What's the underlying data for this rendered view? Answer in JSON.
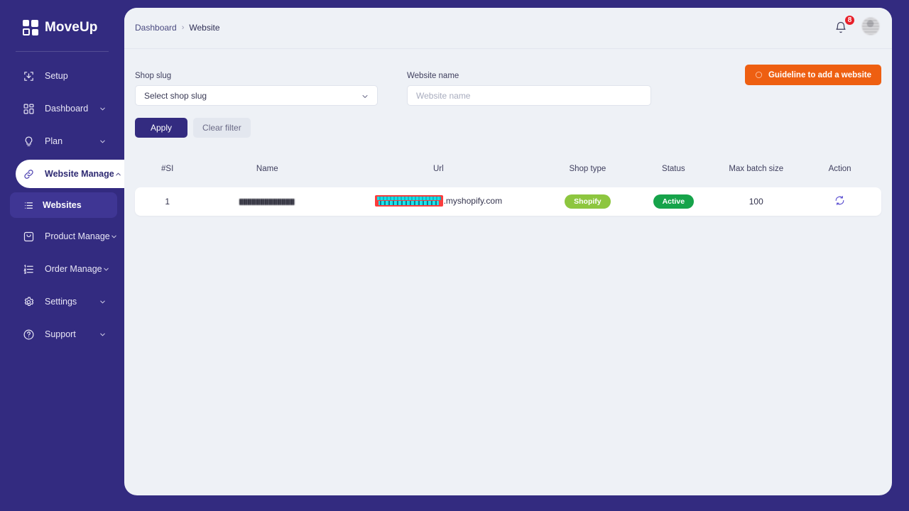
{
  "brand": {
    "name": "MoveUp",
    "sidebar_color": "#332b80",
    "accent_color": "#332b80",
    "orange_color": "#ee5f11"
  },
  "sidebar": {
    "items": [
      {
        "label": "Setup",
        "icon": "download-box-icon",
        "has_chevron": false,
        "active": false
      },
      {
        "label": "Dashboard",
        "icon": "grid-icon",
        "has_chevron": true,
        "active": false
      },
      {
        "label": "Plan",
        "icon": "lightbulb-icon",
        "has_chevron": true,
        "active": false
      },
      {
        "label": "Website Manage",
        "icon": "link-icon",
        "has_chevron": true,
        "active": true
      },
      {
        "label": "Product Manage",
        "icon": "bag-icon",
        "has_chevron": true,
        "active": false
      },
      {
        "label": "Order Manage",
        "icon": "ordered-list-icon",
        "has_chevron": true,
        "active": false
      },
      {
        "label": "Settings",
        "icon": "gear-icon",
        "has_chevron": true,
        "active": false
      },
      {
        "label": "Support",
        "icon": "question-circle-icon",
        "has_chevron": true,
        "active": false
      }
    ],
    "sub_item": {
      "label": "Websites",
      "icon": "list-icon"
    }
  },
  "topbar": {
    "breadcrumb": {
      "root": "Dashboard",
      "separator": "›",
      "current": "Website"
    },
    "notification_count": "8",
    "bell_icon": "bell-icon",
    "avatar": "user-avatar"
  },
  "filters": {
    "shop_slug": {
      "label": "Shop slug",
      "value": "Select shop slug"
    },
    "website_name": {
      "label": "Website name",
      "value": "",
      "placeholder": "Website name"
    },
    "apply_label": "Apply",
    "clear_label": "Clear filter",
    "guideline_label": "Guideline to add a website",
    "guideline_icon": "circle-icon"
  },
  "table": {
    "columns": [
      "#SI",
      "Name",
      "Url",
      "Shop type",
      "Status",
      "Max batch size",
      "Action"
    ],
    "rows": [
      {
        "si": "1",
        "name": "",
        "url_prefix": "",
        "url_suffix": ".myshopify.com",
        "shop_type": "Shopify",
        "status": "Active",
        "max_batch_size": "100",
        "action_icon": "refresh-icon"
      }
    ]
  }
}
